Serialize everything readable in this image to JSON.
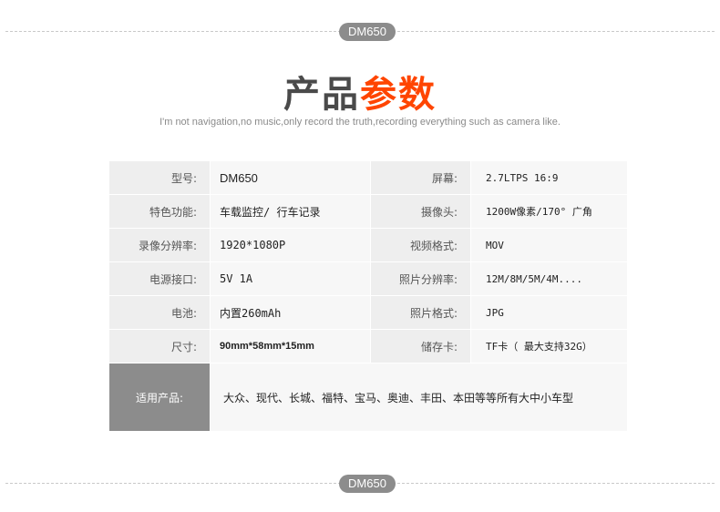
{
  "badge": "DM650",
  "title": {
    "part1": "产品",
    "part2": "参数"
  },
  "subtitle": "I'm not navigation,no music,only record the truth,recording everything such as camera like.",
  "rows": [
    {
      "label1": "型号:",
      "value1": "DM650",
      "label2": "屏幕:",
      "value2": "2.7LTPS  16:9"
    },
    {
      "label1": "特色功能:",
      "value1": "车载监控/ 行车记录",
      "label2": "摄像头:",
      "value2": "1200W像素/170° 广角"
    },
    {
      "label1": "录像分辨率:",
      "value1": "1920*1080P",
      "label2": "视频格式:",
      "value2": "MOV"
    },
    {
      "label1": "电源接口:",
      "value1": "5V 1A",
      "label2": "照片分辨率:",
      "value2": "12M/8M/5M/4M...."
    },
    {
      "label1": "电池:",
      "value1": "内置260mAh",
      "label2": "照片格式:",
      "value2": "JPG"
    },
    {
      "label1": "尺寸:",
      "value1": "90mm*58mm*15mm",
      "label2": "储存卡:",
      "value2": "TF卡（ 最大支持32G）"
    }
  ],
  "applicable": {
    "label": "适用产品:",
    "value": "大众、现代、长城、福特、宝马、奥迪、丰田、本田等等所有大中小车型"
  }
}
